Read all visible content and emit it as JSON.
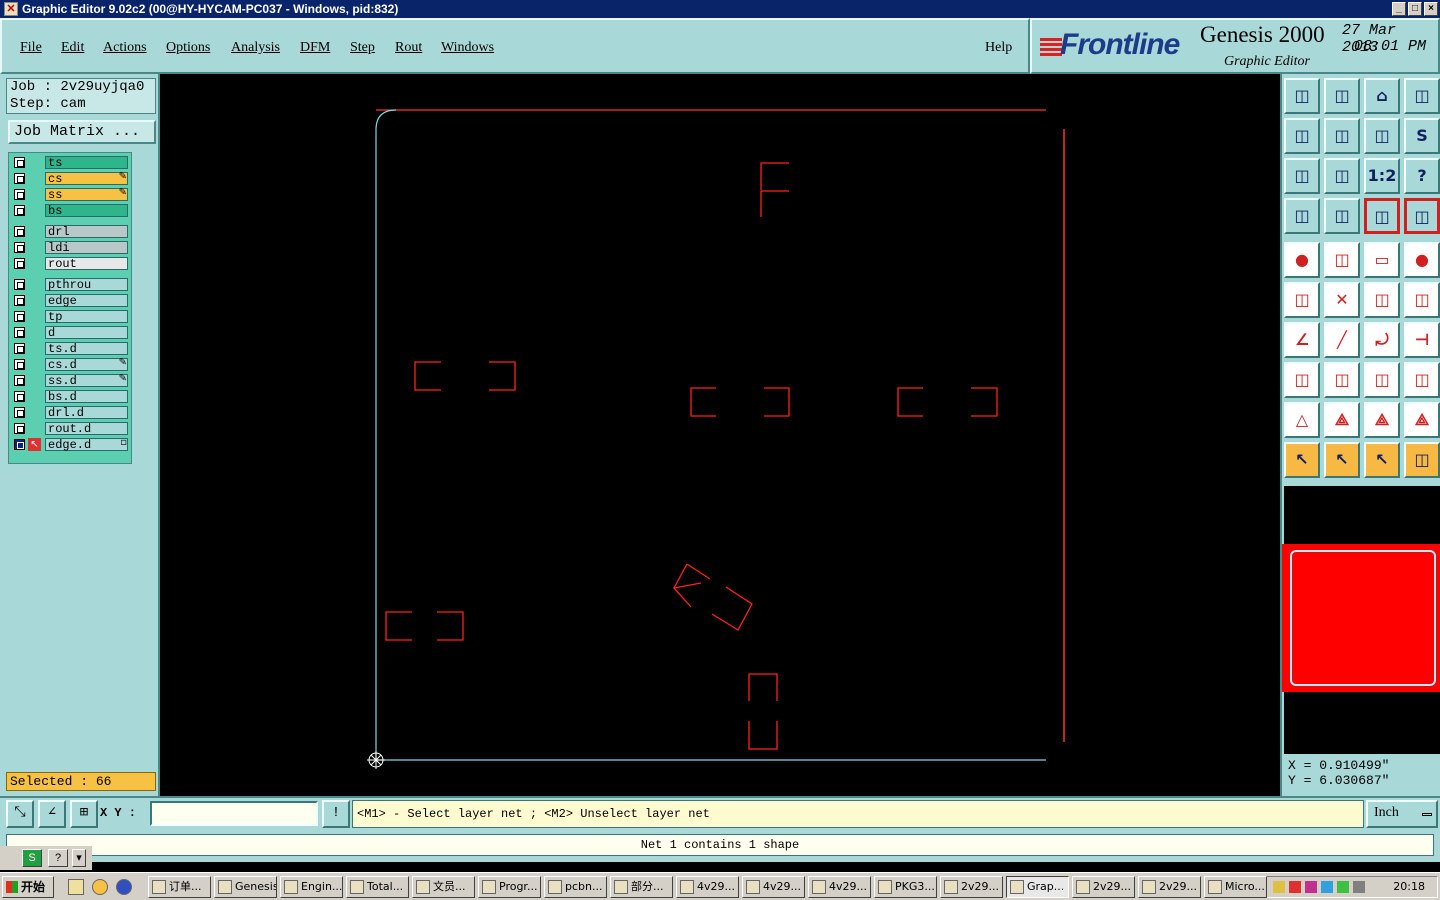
{
  "window": {
    "title": "Graphic Editor 9.02c2 (00@HY-HYCAM-PC037 - Windows, pid:832)"
  },
  "menu": {
    "items": [
      "File",
      "Edit",
      "Actions",
      "Options",
      "Analysis",
      "DFM",
      "Step",
      "Rout",
      "Windows"
    ],
    "help": "Help"
  },
  "brand": {
    "logo": "Frontline",
    "product": "Genesis 2000",
    "subtitle": "Graphic Editor",
    "date": "27 Mar 2013",
    "time": "08:01 PM"
  },
  "job": {
    "job_line": "Job : 2v29uyjqa0",
    "step_line": "Step: cam",
    "matrix_button": "Job Matrix ..."
  },
  "layers": [
    {
      "name": "ts",
      "color": "#2fb58a",
      "mark": ""
    },
    {
      "name": "cs",
      "color": "#f7c244",
      "mark": "✎"
    },
    {
      "name": "ss",
      "color": "#f7c244",
      "mark": "✎"
    },
    {
      "name": "bs",
      "color": "#2fb58a",
      "mark": ""
    },
    {
      "name": "drl",
      "color": "#b8c8c8",
      "mark": ""
    },
    {
      "name": "ldi",
      "color": "#b8c8c8",
      "mark": ""
    },
    {
      "name": "rout",
      "color": "#e8e8e8",
      "mark": ""
    },
    {
      "name": "pthrou",
      "color": "#a8d8d8",
      "mark": ""
    },
    {
      "name": "edge",
      "color": "#a8d8d8",
      "mark": ""
    },
    {
      "name": "tp",
      "color": "#a8d8d8",
      "mark": ""
    },
    {
      "name": "d",
      "color": "#a8d8d8",
      "mark": ""
    },
    {
      "name": "ts.d",
      "color": "#a8d8d8",
      "mark": ""
    },
    {
      "name": "cs.d",
      "color": "#a8d8d8",
      "mark": "✎"
    },
    {
      "name": "ss.d",
      "color": "#a8d8d8",
      "mark": "✎"
    },
    {
      "name": "bs.d",
      "color": "#a8d8d8",
      "mark": ""
    },
    {
      "name": "drl.d",
      "color": "#a8d8d8",
      "mark": ""
    },
    {
      "name": "rout.d",
      "color": "#a8d8d8",
      "mark": ""
    },
    {
      "name": "edge.d",
      "color": "#a8d8d8",
      "mark": "▫"
    }
  ],
  "selected": "Selected : 66",
  "coords": {
    "x": "X = 0.910499\"",
    "y": "Y = 6.030687\""
  },
  "command": {
    "xy_label": "X Y :",
    "xy_value": "",
    "prompt": "<M1> - Select layer net ; <M2> Unselect layer net",
    "unit": "Inch"
  },
  "status": "Net 1 contains 1 shape",
  "taskbar": {
    "start": "开始",
    "tasks": [
      {
        "label": "订单...",
        "active": false
      },
      {
        "label": "Genesis",
        "active": false
      },
      {
        "label": "Engin...",
        "active": false
      },
      {
        "label": "Total...",
        "active": false
      },
      {
        "label": "文员...",
        "active": false
      },
      {
        "label": "Progr...",
        "active": false
      },
      {
        "label": "pcbn...",
        "active": false
      },
      {
        "label": "部分...",
        "active": false
      },
      {
        "label": "4v29...",
        "active": false
      },
      {
        "label": "4v29...",
        "active": false
      },
      {
        "label": "4v29...",
        "active": false
      },
      {
        "label": "PKG3...",
        "active": false
      },
      {
        "label": "2v29...",
        "active": false
      },
      {
        "label": "Grap...",
        "active": true
      },
      {
        "label": "2v29...",
        "active": false
      },
      {
        "label": "2v29...",
        "active": false
      },
      {
        "label": "Micro...",
        "active": false
      }
    ],
    "clock": "20:18"
  },
  "colors": {
    "panel": "#a8d8d8",
    "board_outline": "#7fd8e0",
    "pads": "#ff2020",
    "accent_selected": "#f7c244"
  }
}
